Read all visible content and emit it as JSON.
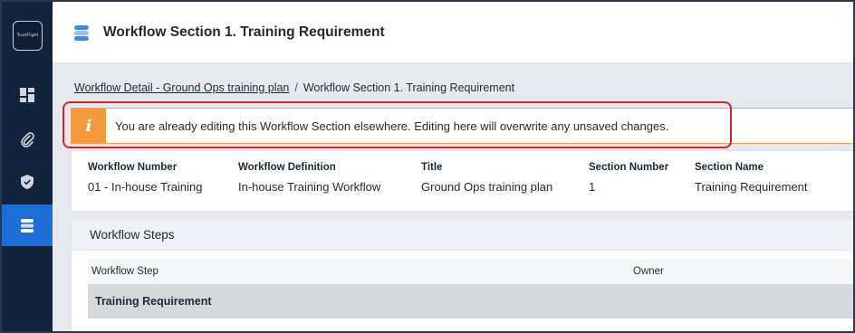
{
  "app": {
    "logo_text": "TrustFlight"
  },
  "sidebar": {
    "items": [
      {
        "icon": "dashboard-icon",
        "active": false
      },
      {
        "icon": "paperclip-icon",
        "active": false
      },
      {
        "icon": "shield-icon",
        "active": false
      },
      {
        "icon": "workflow-icon",
        "active": true
      }
    ]
  },
  "header": {
    "title": "Workflow Section 1. Training Requirement",
    "icon": "workflow-icon"
  },
  "breadcrumb": {
    "parent": "Workflow Detail - Ground Ops training plan",
    "separator": "/",
    "current": "Workflow Section 1. Training Requirement"
  },
  "alert": {
    "icon": "i",
    "message": "You are already editing this Workflow Section elsewhere. Editing here will overwrite any unsaved changes.",
    "color": "#f59a3c"
  },
  "details": {
    "fields": [
      {
        "label": "Workflow Number",
        "value": "01 - In-house Training"
      },
      {
        "label": "Workflow Definition",
        "value": "In-house Training Workflow"
      },
      {
        "label": "Title",
        "value": "Ground Ops training plan"
      },
      {
        "label": "Section Number",
        "value": "1"
      },
      {
        "label": "Section Name",
        "value": "Training Requirement"
      }
    ]
  },
  "steps": {
    "title": "Workflow Steps",
    "columns": [
      "Workflow Step",
      "Owner"
    ],
    "rows": [
      {
        "step": "Training Requirement",
        "owner": ""
      }
    ]
  },
  "colors": {
    "sidebar_bg": "#13233b",
    "active_nav": "#1d6fd8",
    "highlight": "#d8222b"
  }
}
